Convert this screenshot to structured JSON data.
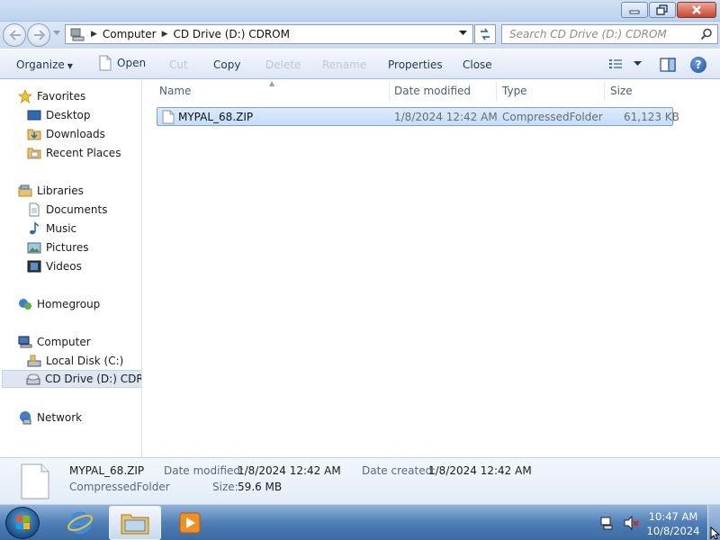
{
  "window": {
    "buttons": {
      "minimize": "minimize",
      "restore": "restore",
      "close": "close"
    }
  },
  "address": {
    "crumbs": [
      "Computer",
      "CD Drive (D:) CDROM"
    ],
    "search_placeholder": "Search CD Drive (D:) CDROM"
  },
  "toolbar": {
    "organize": "Organize",
    "open": "Open",
    "cut": "Cut",
    "copy": "Copy",
    "delete": "Delete",
    "rename": "Rename",
    "properties": "Properties",
    "close": "Close",
    "help": "?"
  },
  "nav": {
    "favorites": "Favorites",
    "desktop": "Desktop",
    "downloads": "Downloads",
    "recent": "Recent Places",
    "libraries": "Libraries",
    "documents": "Documents",
    "music": "Music",
    "pictures": "Pictures",
    "videos": "Videos",
    "homegroup": "Homegroup",
    "computer": "Computer",
    "local_disk": "Local Disk (C:)",
    "cd_drive": "CD Drive (D:) CDROM",
    "network": "Network"
  },
  "columns": {
    "name": "Name",
    "date": "Date modified",
    "type": "Type",
    "size": "Size"
  },
  "files": [
    {
      "name": "MYPAL_68.ZIP",
      "date": "1/8/2024 12:42 AM",
      "type": "CompressedFolder",
      "size": "61,123 KB"
    }
  ],
  "details": {
    "name": "MYPAL_68.ZIP",
    "type": "CompressedFolder",
    "modified_label": "Date modified:",
    "modified_value": "1/8/2024 12:42 AM",
    "created_label": "Date created:",
    "created_value": "1/8/2024 12:42 AM",
    "size_label": "Size:",
    "size_value": "59.6 MB"
  },
  "taskbar": {
    "time": "10:47 AM",
    "date": "10/8/2024"
  },
  "colors": {
    "selection": "#cce0f8",
    "toolbar_text": "#1e395b",
    "taskbar": "#4f7fb6"
  }
}
